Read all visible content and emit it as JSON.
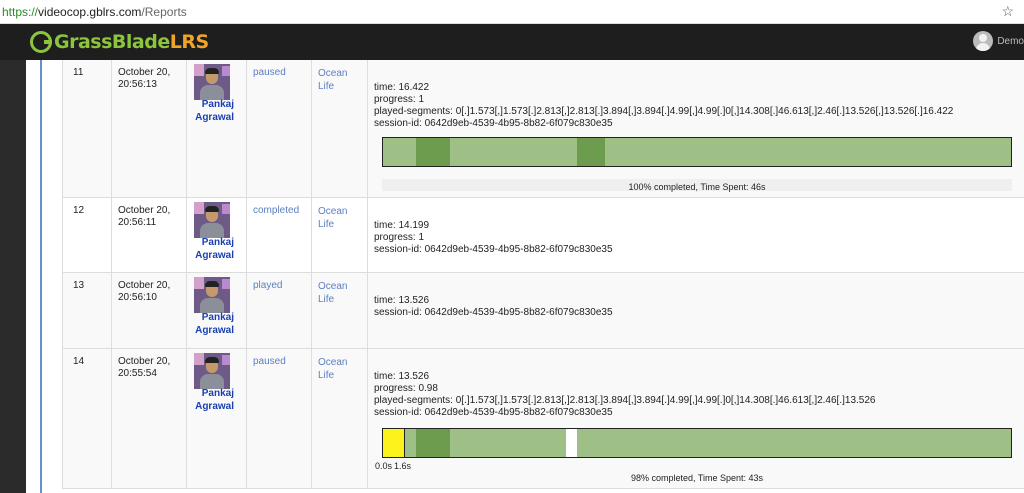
{
  "browser": {
    "url_scheme": "https://",
    "url_host": "videocop.gblrs.com",
    "url_path": "/Reports",
    "star_icon": "star-icon"
  },
  "header": {
    "logo_part1": "GrassBlade",
    "logo_part2": "LRS",
    "user_name": "Demo"
  },
  "rows": [
    {
      "num": "11",
      "date_line1": "October 20,",
      "date_line2": "20:56:13",
      "actor_first": "Pankaj",
      "actor_last": "Agrawal",
      "verb": "paused",
      "object_line1": "Ocean",
      "object_line2": "Life",
      "details": [
        "time: 16.422",
        "progress: 1",
        "played-segments: 0[.]1.573[,]1.573[.]2.813[,]2.813[.]3.894[,]3.894[.]4.99[,]4.99[.]0[,]14.308[.]46.613[,]2.46[.]13.526[,]13.526[.]16.422",
        "session-id: 0642d9eb-4539-4b95-8b82-6f079c830e35"
      ],
      "caption": "100% completed, Time Spent: 46s"
    },
    {
      "num": "12",
      "date_line1": "October 20,",
      "date_line2": "20:56:11",
      "actor_first": "Pankaj",
      "actor_last": "Agrawal",
      "verb": "completed",
      "object_line1": "Ocean",
      "object_line2": "Life",
      "details": [
        "time: 14.199",
        "progress: 1",
        "session-id: 0642d9eb-4539-4b95-8b82-6f079c830e35"
      ]
    },
    {
      "num": "13",
      "date_line1": "October 20,",
      "date_line2": "20:56:10",
      "actor_first": "Pankaj",
      "actor_last": "Agrawal",
      "verb": "played",
      "object_line1": "Ocean",
      "object_line2": "Life",
      "details": [
        "time: 13.526",
        "session-id: 0642d9eb-4539-4b95-8b82-6f079c830e35"
      ]
    },
    {
      "num": "14",
      "date_line1": "October 20,",
      "date_line2": "20:55:54",
      "actor_first": "Pankaj",
      "actor_last": "Agrawal",
      "verb": "paused",
      "object_line1": "Ocean",
      "object_line2": "Life",
      "details": [
        "time: 13.526",
        "progress: 0.98",
        "played-segments: 0[.]1.573[,]1.573[.]2.813[,]2.813[.]3.894[,]3.894[.]4.99[,]4.99[.]0[,]14.308[.]46.613[,]2.46[.]13.526",
        "session-id: 0642d9eb-4539-4b95-8b82-6f079c830e35"
      ],
      "tick_start": "0.0s",
      "tick_end": "1.6s",
      "caption": "98% completed, Time Spent: 43s"
    }
  ],
  "colors": {
    "played": "#9ebf86",
    "replayed": "#6e9c4e",
    "unplayed": "#ffffff",
    "current": "#fbf31b",
    "link": "#5b7fc4",
    "actor": "#1a3fb3"
  }
}
